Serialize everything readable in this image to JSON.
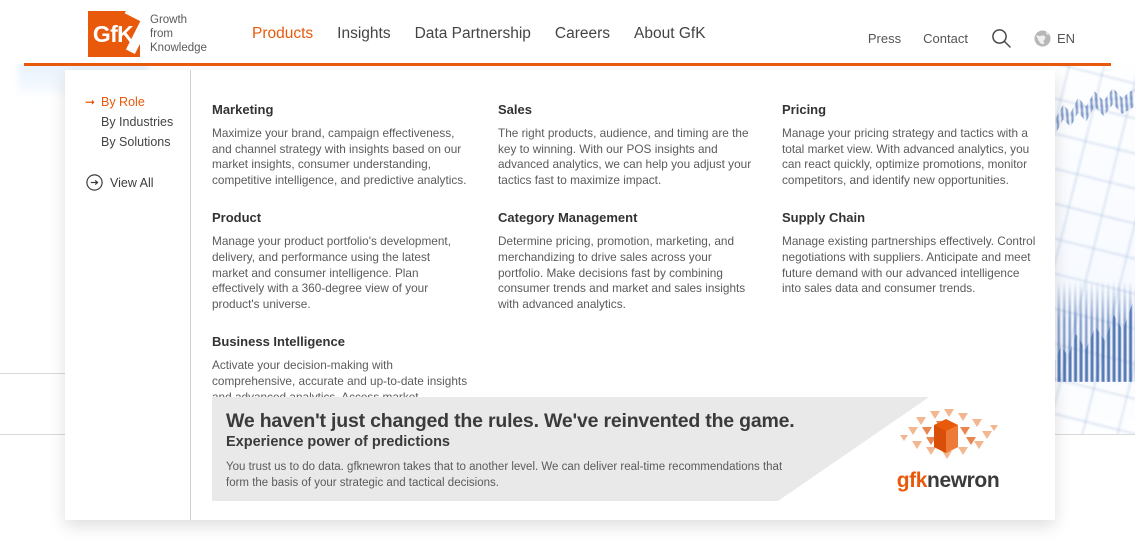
{
  "header": {
    "logo": {
      "mark_text": "GfK",
      "tagline_line1": "Growth",
      "tagline_line2": "from",
      "tagline_line3": "Knowledge"
    },
    "nav": [
      {
        "label": "Products",
        "active": true
      },
      {
        "label": "Insights",
        "active": false
      },
      {
        "label": "Data Partnership",
        "active": false
      },
      {
        "label": "Careers",
        "active": false
      },
      {
        "label": "About GfK",
        "active": false
      }
    ],
    "utility": {
      "press": "Press",
      "contact": "Contact",
      "search_icon": "search-icon",
      "globe_icon": "globe-icon",
      "language": "EN"
    },
    "accent_color": "#e8590c"
  },
  "mega_menu": {
    "sidebar": {
      "items": [
        {
          "label": "By Role",
          "active": true
        },
        {
          "label": "By Industries",
          "active": false
        },
        {
          "label": "By Solutions",
          "active": false
        }
      ],
      "view_all": {
        "label": "View All",
        "icon": "circle-arrow-right-icon"
      }
    },
    "columns": [
      {
        "entries": [
          {
            "title": "Marketing",
            "desc": "Maximize your brand, campaign effectiveness, and channel strategy with insights based on our market insights, consumer understanding, competitive intelligence, and predictive analytics."
          },
          {
            "title": "Product",
            "desc": "Manage your product portfolio's development, delivery, and performance using the latest market and consumer intelligence. Plan effectively with a 360-degree view of your product's universe."
          },
          {
            "title": "Business Intelligence",
            "desc": "Activate your decision-making with comprehensive, accurate and up-to-date insights and advanced analytics. Access market, consumer, and competitive intelligence to improve your planning."
          }
        ]
      },
      {
        "entries": [
          {
            "title": "Sales",
            "desc": "The right products, audience, and timing are the key to winning. With our POS insights and advanced analytics, we can help you adjust your tactics fast to maximize impact."
          },
          {
            "title": "Category Management",
            "desc": "Determine pricing, promotion, marketing, and merchandizing to drive sales across your portfolio. Make decisions fast by combining consumer trends and market and sales insights with advanced analytics."
          }
        ]
      },
      {
        "entries": [
          {
            "title": "Pricing",
            "desc": "Manage your pricing strategy and tactics with a total market view. With advanced analytics, you can react quickly, optimize promotions, monitor competitors, and identify new opportunities."
          },
          {
            "title": "Supply Chain",
            "desc": "Manage existing partnerships effectively. Control negotiations with suppliers. Anticipate and meet future demand with our advanced intelligence into sales data and consumer trends."
          }
        ]
      }
    ],
    "promo": {
      "headline": "We haven't just changed the rules. We've reinvented the game.",
      "subhead": "Experience power of predictions",
      "body": "You trust us to do data. gfknewron takes that to another level. We can deliver real-time recommendations that form the basis of your strategic and tactical decisions.",
      "logo": {
        "part1": "gfk",
        "part2": "newron",
        "graphic": "cube-triangles-icon"
      },
      "background_color": "#e9e9e9"
    }
  }
}
